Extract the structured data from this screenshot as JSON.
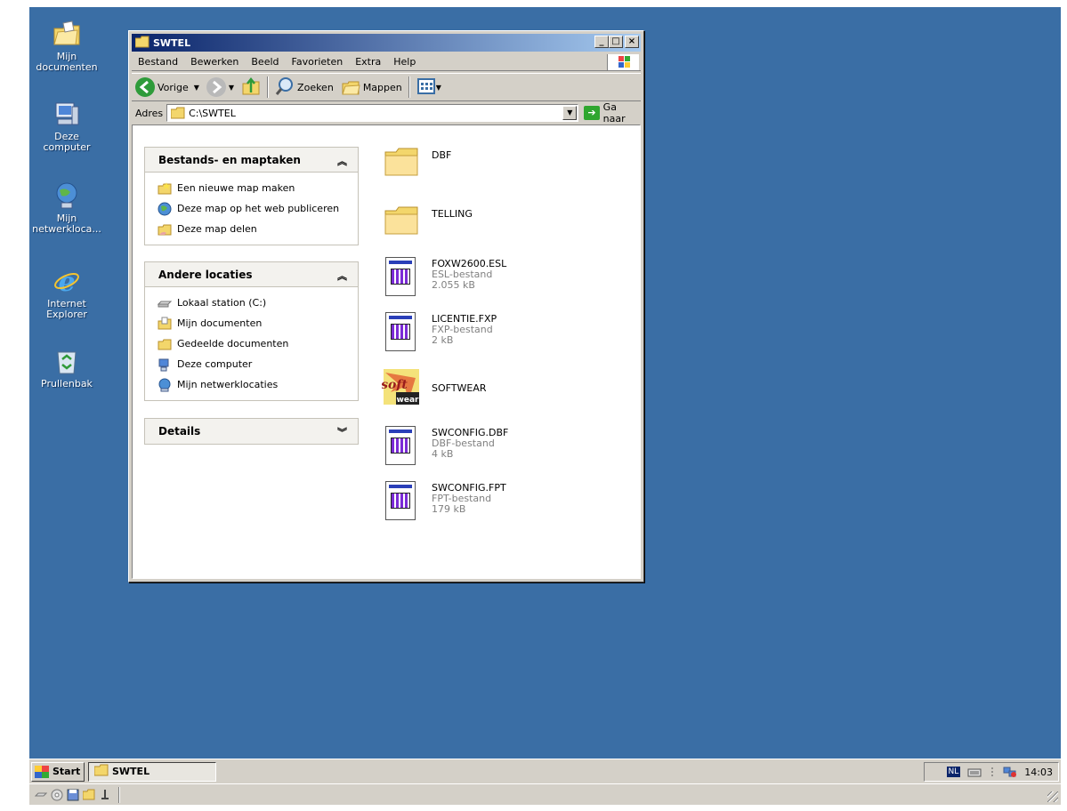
{
  "desktop": {
    "icons": [
      {
        "label_1": "Mijn",
        "label_2": "documenten",
        "icon": "my-documents-icon"
      },
      {
        "label_1": "Deze computer",
        "label_2": "",
        "icon": "my-computer-icon"
      },
      {
        "label_1": "Mijn",
        "label_2": "netwerkloca...",
        "icon": "network-places-icon"
      },
      {
        "label_1": "Internet",
        "label_2": "Explorer",
        "icon": "internet-explorer-icon"
      },
      {
        "label_1": "Prullenbak",
        "label_2": "",
        "icon": "recycle-bin-icon"
      }
    ],
    "background_color": "#3a6ea5"
  },
  "window": {
    "title": "SWTEL",
    "buttons": {
      "minimize": "_",
      "maximize": "□",
      "close": "×"
    },
    "menu": [
      "Bestand",
      "Bewerken",
      "Beeld",
      "Favorieten",
      "Extra",
      "Help"
    ],
    "toolbar": {
      "back_label": "Vorige",
      "search_label": "Zoeken",
      "folders_label": "Mappen"
    },
    "address": {
      "label": "Adres",
      "value": "C:\\SWTEL",
      "go_label": "Ga naar"
    }
  },
  "panels": {
    "tasks": {
      "title": "Bestands- en maptaken",
      "items": [
        {
          "label": "Een nieuwe map maken",
          "icon": "new-folder-icon"
        },
        {
          "label": "Deze map op het web publiceren",
          "icon": "web-publish-icon"
        },
        {
          "label": "Deze map delen",
          "icon": "share-folder-icon"
        }
      ]
    },
    "other": {
      "title": "Andere locaties",
      "items": [
        {
          "label": "Lokaal station (C:)",
          "icon": "drive-icon"
        },
        {
          "label": "Mijn documenten",
          "icon": "my-documents-icon"
        },
        {
          "label": "Gedeelde documenten",
          "icon": "shared-documents-icon"
        },
        {
          "label": "Deze computer",
          "icon": "my-computer-icon"
        },
        {
          "label": "Mijn netwerklocaties",
          "icon": "network-places-icon"
        }
      ]
    },
    "details": {
      "title": "Details"
    }
  },
  "files": [
    {
      "name": "DBF",
      "type": "",
      "size": "",
      "kind": "folder"
    },
    {
      "name": "TELLING",
      "type": "",
      "size": "",
      "kind": "folder"
    },
    {
      "name": "FOXW2600.ESL",
      "type": "ESL-bestand",
      "size": "2.055 kB",
      "kind": "doc"
    },
    {
      "name": "LICENTIE.FXP",
      "type": "FXP-bestand",
      "size": "2 kB",
      "kind": "doc"
    },
    {
      "name": "SOFTWEAR",
      "type": "",
      "size": "",
      "kind": "app"
    },
    {
      "name": "SWCONFIG.DBF",
      "type": "DBF-bestand",
      "size": "4 kB",
      "kind": "doc"
    },
    {
      "name": "SWCONFIG.FPT",
      "type": "FPT-bestand",
      "size": "179 kB",
      "kind": "doc"
    }
  ],
  "taskbar": {
    "start_label": "Start",
    "task_label": "SWTEL",
    "language": "NL",
    "clock": "14:03"
  }
}
